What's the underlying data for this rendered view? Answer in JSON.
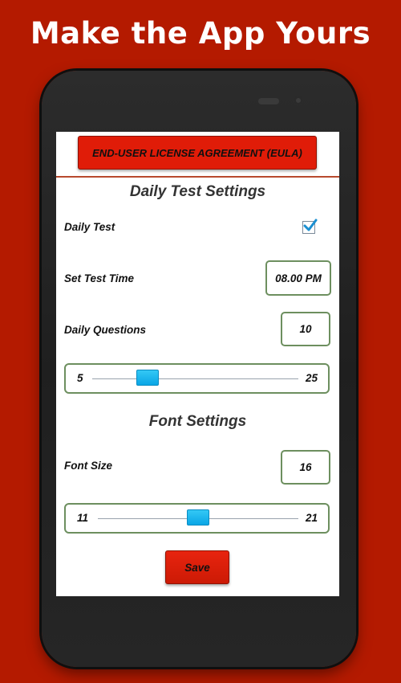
{
  "promo": {
    "headline": "Make the App Yours"
  },
  "eula": {
    "label": "END-USER LICENSE AGREEMENT (EULA)"
  },
  "daily_test_settings": {
    "title": "Daily Test Settings",
    "daily_test": {
      "label": "Daily Test",
      "checked": true
    },
    "test_time": {
      "label": "Set Test Time",
      "value": "08.00 PM"
    },
    "daily_questions": {
      "label": "Daily Questions",
      "value": "10",
      "slider": {
        "min": "5",
        "max": "25",
        "current": 10
      }
    }
  },
  "font_settings": {
    "title": "Font Settings",
    "font_size": {
      "label": "Font Size",
      "value": "16",
      "slider": {
        "min": "11",
        "max": "21",
        "current": 16
      }
    }
  },
  "actions": {
    "save_label": "Save"
  },
  "colors": {
    "background": "#b41a00",
    "button_red": "#e01c08",
    "box_border": "#6d8f5f",
    "slider_thumb": "#12b4ee",
    "checkmark": "#1a8fd1"
  }
}
